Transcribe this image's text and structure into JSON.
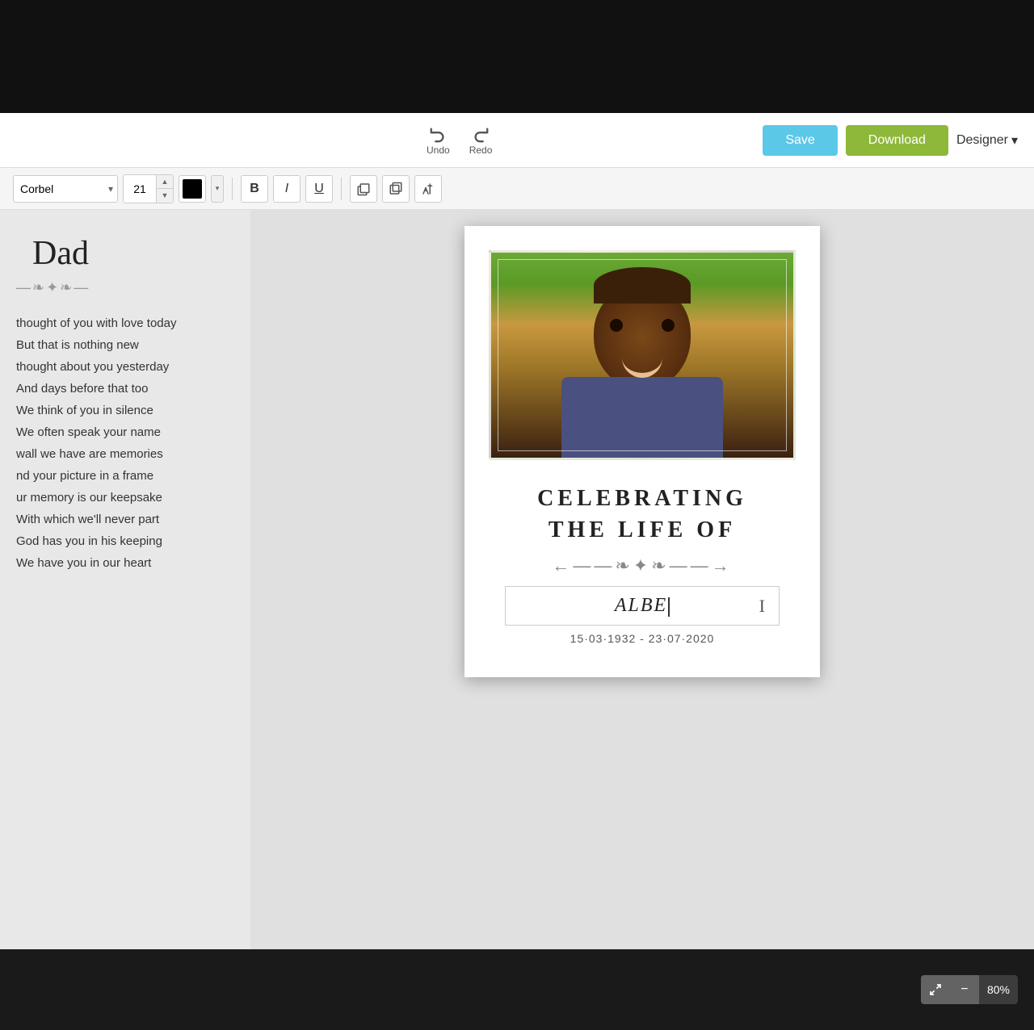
{
  "topBar": {},
  "toolbar": {
    "undoLabel": "Undo",
    "redoLabel": "Redo",
    "saveLabel": "Save",
    "downloadLabel": "Download",
    "designerLabel": "Designer"
  },
  "formatBar": {
    "fontFamily": "Corbel",
    "fontSize": "21",
    "boldLabel": "B",
    "italicLabel": "I",
    "underlineLabel": "U"
  },
  "sidebar": {
    "title": "Dad",
    "divider": "—❧✦❧—",
    "poem": [
      "thought of you with love today",
      "But that is nothing new",
      "thought about you yesterday",
      "And days before that too",
      "We think of you in silence",
      "We often speak your name",
      "wall we have are memories",
      "nd your picture in a frame",
      "ur memory is our keepsake",
      "With which we'll never part",
      "God has you in his keeping",
      "We have you in our heart"
    ]
  },
  "card": {
    "celebratingLine1": "CELEBRATING",
    "celebratingLine2": "THE LIFE OF",
    "ornament": "←——❧✦❧——→",
    "namePlaceholder": "ALBE",
    "dates": "15·03·1932 - 23·07·2020"
  },
  "bottomBar": {
    "zoomLevel": "80%"
  }
}
